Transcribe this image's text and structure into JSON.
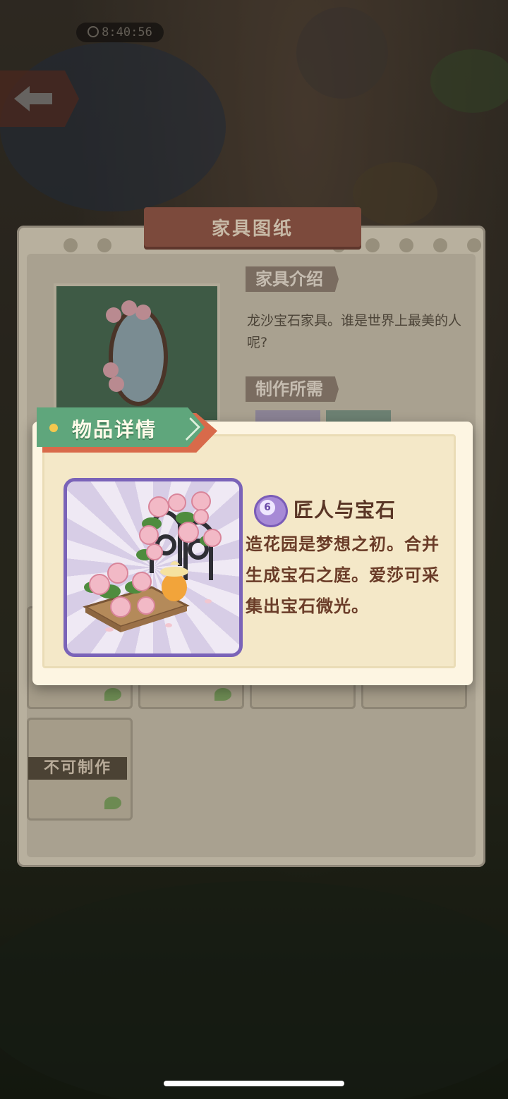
{
  "status_bar": {
    "timer": "8:40:56"
  },
  "nav": {
    "back_icon": "arrow-left-icon"
  },
  "blueprint_panel": {
    "title": "家具图纸",
    "intro_heading": "家具介绍",
    "intro_text": "龙沙宝石家具。谁是世界上最美的人呢?",
    "requirements_heading": "制作所需",
    "locked_item_label": "不可制作"
  },
  "item_detail": {
    "tab_label": "物品详情",
    "level": "6",
    "name": "匠人与宝石",
    "description": "造花园是梦想之初。合并生成宝石之庭。爱莎可采集出宝石微光。",
    "card_border_color": "#7a63b8",
    "tab_color": "#5fa67c"
  }
}
